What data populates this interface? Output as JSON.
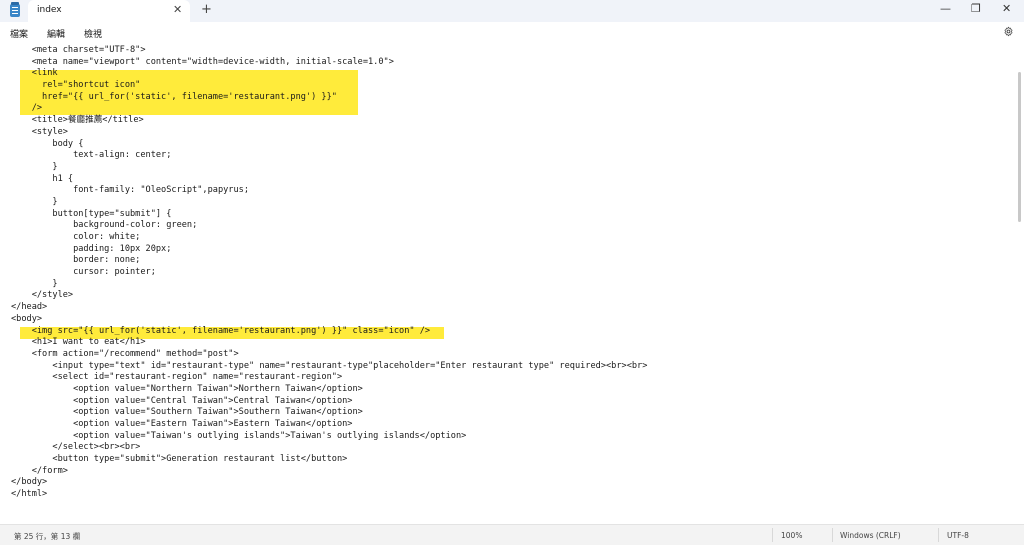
{
  "tab": {
    "title": "index",
    "close_glyph": "✕",
    "new_glyph": "+"
  },
  "window_controls": {
    "minimize": "—",
    "maximize": "❐",
    "close": "✕"
  },
  "menu": {
    "file": "檔案",
    "edit": "編輯",
    "view": "檢視"
  },
  "icons": {
    "app": "notepad-icon",
    "settings": "gear-icon"
  },
  "colors": {
    "highlight": "#ffeb3b",
    "titlebar": "#f0f3f9"
  },
  "code_lines": [
    "    <meta charset=\"UTF-8\">",
    "    <meta name=\"viewport\" content=\"width=device-width, initial-scale=1.0\">",
    "    <link",
    "      rel=\"shortcut icon\"",
    "      href=\"{{ url_for('static', filename='restaurant.png') }}\"",
    "    />",
    "    <title>餐廳推薦</title>",
    "    <style>",
    "        body {",
    "            text-align: center;",
    "        }",
    "        h1 {",
    "            font-family: \"OleoScript\",papyrus;",
    "        }",
    "        button[type=\"submit\"] {",
    "            background-color: green;",
    "            color: white;",
    "            padding: 10px 20px;",
    "            border: none;",
    "            cursor: pointer;",
    "        }",
    "    </style>",
    "</head>",
    "<body>",
    "    <img src=\"{{ url_for('static', filename='restaurant.png') }}\" class=\"icon\" />",
    "    <h1>I want to eat</h1>",
    "    <form action=\"/recommend\" method=\"post\">",
    "        <input type=\"text\" id=\"restaurant-type\" name=\"restaurant-type\"placeholder=\"Enter restaurant type\" required><br><br>",
    "        <select id=\"restaurant-region\" name=\"restaurant-region\">",
    "            <option value=\"Northern Taiwan\">Northern Taiwan</option>",
    "            <option value=\"Central Taiwan\">Central Taiwan</option>",
    "            <option value=\"Southern Taiwan\">Southern Taiwan</option>",
    "            <option value=\"Eastern Taiwan\">Eastern Taiwan</option>",
    "            <option value=\"Taiwan's outlying islands\">Taiwan's outlying islands</option>",
    "        </select><br><br>",
    "        <button type=\"submit\">Generation restaurant list</button>",
    "    </form>",
    "</body>",
    "</html>"
  ],
  "status": {
    "position": "第 25 行，第 13 欄",
    "zoom": "100%",
    "line_ending": "Windows (CRLF)",
    "encoding": "UTF-8"
  }
}
